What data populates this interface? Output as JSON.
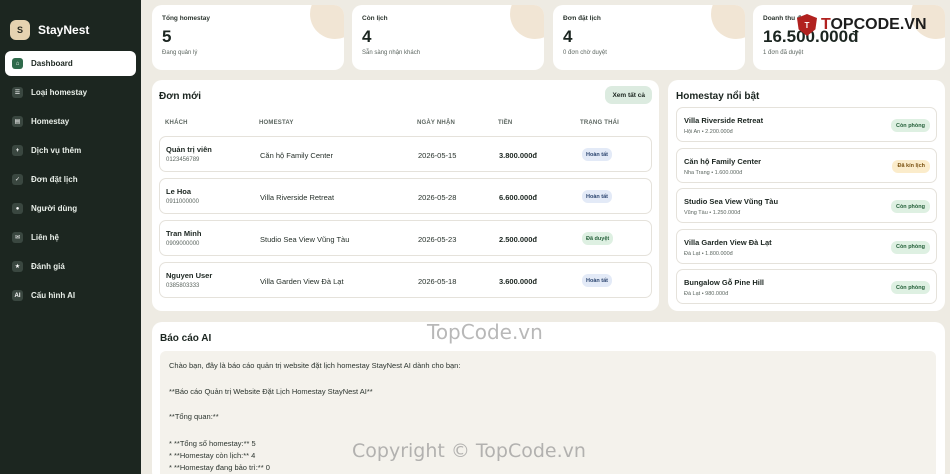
{
  "brand": {
    "logo": "S",
    "name": "StayNest"
  },
  "sidebar": {
    "items": [
      {
        "label": "Dashboard",
        "icon": "home-icon",
        "glyph": "⌂",
        "active": true
      },
      {
        "label": "Loại homestay",
        "icon": "list-icon",
        "glyph": "☰"
      },
      {
        "label": "Homestay",
        "icon": "house-icon",
        "glyph": "▤"
      },
      {
        "label": "Dịch vụ thêm",
        "icon": "plus-icon",
        "glyph": "+"
      },
      {
        "label": "Đơn đặt lịch",
        "icon": "check-icon",
        "glyph": "✓"
      },
      {
        "label": "Người dùng",
        "icon": "user-icon",
        "glyph": "●"
      },
      {
        "label": "Liên hệ",
        "icon": "mail-icon",
        "glyph": "✉"
      },
      {
        "label": "Đánh giá",
        "icon": "star-icon",
        "glyph": "★"
      },
      {
        "label": "Cấu hình AI",
        "icon": "ai-icon",
        "glyph": "AI"
      }
    ]
  },
  "stats": [
    {
      "label": "Tổng homestay",
      "value": "5",
      "sub": "Đang quản lý"
    },
    {
      "label": "Còn lịch",
      "value": "4",
      "sub": "Sẵn sàng nhận khách"
    },
    {
      "label": "Đơn đặt lịch",
      "value": "4",
      "sub": "0 đơn chờ duyệt"
    },
    {
      "label": "Doanh thu đ",
      "value": "16.500.000đ",
      "sub": "1 đơn đã duyệt"
    }
  ],
  "orders": {
    "title": "Đơn mới",
    "view_all": "Xem tất cả",
    "columns": [
      "KHÁCH",
      "HOMESTAY",
      "NGÀY NHẬN",
      "TIỀN",
      "TRẠNG THÁI"
    ],
    "rows": [
      {
        "name": "Quản trị viên",
        "phone": "0123456789",
        "homestay": "Căn hộ Family Center",
        "date": "2026-05-15",
        "amount": "3.800.000đ",
        "status": "Hoàn tất",
        "status_type": "done"
      },
      {
        "name": "Le Hoa",
        "phone": "0911000000",
        "homestay": "Villa Riverside Retreat",
        "date": "2026-05-28",
        "amount": "6.600.000đ",
        "status": "Hoàn tất",
        "status_type": "done"
      },
      {
        "name": "Tran Minh",
        "phone": "0909000000",
        "homestay": "Studio Sea View Vũng Tàu",
        "date": "2026-05-23",
        "amount": "2.500.000đ",
        "status": "Đã duyệt",
        "status_type": "ok"
      },
      {
        "name": "Nguyen User",
        "phone": "0385803333",
        "homestay": "Villa Garden View Đà Lạt",
        "date": "2026-05-18",
        "amount": "3.600.000đ",
        "status": "Hoàn tất",
        "status_type": "done"
      }
    ]
  },
  "featured": {
    "title": "Homestay nổi bật",
    "items": [
      {
        "name": "Villa Riverside Retreat",
        "sub": "Hội An • 2.200.000đ",
        "badge": "Còn phòng",
        "badge_type": "free"
      },
      {
        "name": "Căn hộ Family Center",
        "sub": "Nha Trang • 1.600.000đ",
        "badge": "Đã kín lịch",
        "badge_type": "full"
      },
      {
        "name": "Studio Sea View Vũng Tàu",
        "sub": "Vũng Tàu • 1.250.000đ",
        "badge": "Còn phòng",
        "badge_type": "free"
      },
      {
        "name": "Villa Garden View Đà Lạt",
        "sub": "Đà Lạt • 1.800.000đ",
        "badge": "Còn phòng",
        "badge_type": "free"
      },
      {
        "name": "Bungalow Gỗ Pine Hill",
        "sub": "Đà Lạt • 980.000đ",
        "badge": "Còn phòng",
        "badge_type": "free"
      }
    ]
  },
  "report": {
    "title": "Báo cáo AI",
    "intro": "Chào bạn, đây là báo cáo quản trị website đặt lịch homestay StayNest AI dành cho bạn:",
    "heading": "**Báo cáo Quản trị Website Đặt Lịch Homestay StayNest AI**",
    "overview": "**Tổng quan:**",
    "bullets": [
      "*   **Tổng số homestay:** 5",
      "*   **Homestay còn lịch:** 4",
      "*   **Homestay đang bảo trì:** 0"
    ]
  },
  "watermarks": {
    "top": {
      "prefix": "T",
      "rest": "OPCODE.VN",
      "shield": "T"
    },
    "middle": "TopCode.vn",
    "bottom": "Copyright © TopCode.vn"
  },
  "colors": {
    "sidebar": "#1c2620",
    "background": "#eeebe3",
    "accent": "#2f6a4b",
    "badge_free": "#def0e2",
    "badge_full": "#fbeccb"
  }
}
